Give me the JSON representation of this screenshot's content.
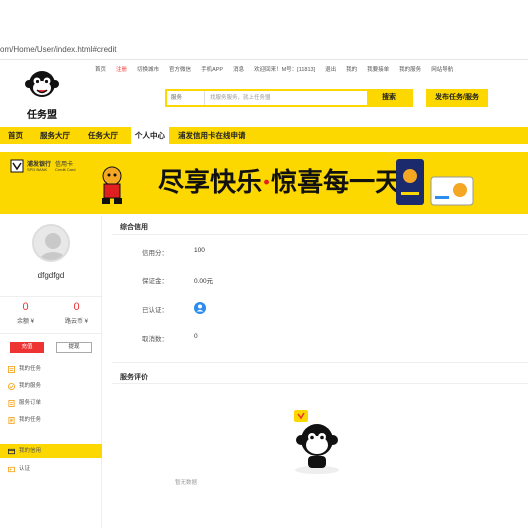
{
  "url": "om/Home/User/index.html#credit",
  "topnav": {
    "items": [
      "首页",
      "注册",
      "切换城市",
      "官方微信",
      "手机APP",
      "消息",
      "欢迎回来！M号：[11813]",
      "退出",
      "我的",
      "我要接单",
      "我的服务",
      "网站导航"
    ]
  },
  "logo": {
    "name": "任务盟"
  },
  "search": {
    "category": "服务",
    "placeholder": "找服务服务，就上任务盟",
    "button": "搜索"
  },
  "publish_button": "发布任务/服务",
  "mainnav": {
    "items": [
      "首页",
      "服务大厅",
      "任务大厅",
      "个人中心",
      "浦发信用卡在线申请"
    ]
  },
  "banner": {
    "bank_name": "浦发银行",
    "bank_sub": "SPD BANK",
    "card_label": "信用卡",
    "card_sub": "Credit Card",
    "slogan_a": "尽享快乐",
    "slogan_b": "·",
    "slogan_c": "惊喜每一天"
  },
  "sidebar": {
    "username": "dfgdfgd",
    "balance_value": "0",
    "balance_label": "余额 ¥",
    "coin_value": "0",
    "coin_label": "路云币 ¥",
    "recharge": "充值",
    "withdraw": "提现",
    "menu": [
      "我的任务",
      "我的服务",
      "服务订单",
      "我的任务",
      "我的信用",
      "认证"
    ]
  },
  "credit": {
    "title": "综合信用",
    "rows": [
      {
        "label": "信用分：",
        "value": "100"
      },
      {
        "label": "保证金：",
        "value": "0.00元"
      },
      {
        "label": "已认证：",
        "value": ""
      },
      {
        "label": "取消数：",
        "value": "0"
      }
    ]
  },
  "evaluation": {
    "title": "服务评价",
    "empty_text": "暂无数据"
  },
  "colors": {
    "brand_yellow": "#fcd800",
    "accent_red": "#e33333",
    "verify_blue": "#2d8cf0"
  }
}
